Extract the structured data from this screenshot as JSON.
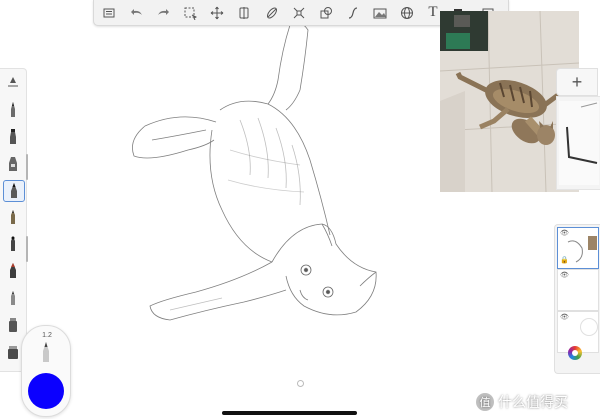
{
  "toolbar": {
    "tools": [
      {
        "icon": "layers-menu-icon"
      },
      {
        "icon": "undo-icon"
      },
      {
        "icon": "redo-icon"
      },
      {
        "icon": "selection-icon"
      },
      {
        "icon": "transform-icon"
      },
      {
        "icon": "symmetry-icon"
      },
      {
        "icon": "ruler-icon"
      },
      {
        "icon": "distort-icon"
      },
      {
        "icon": "shape-icon"
      },
      {
        "icon": "curve-icon"
      },
      {
        "icon": "image-import-icon"
      },
      {
        "icon": "perspective-grid-icon"
      },
      {
        "icon": "text-icon",
        "label": "T"
      },
      {
        "icon": "fill-icon"
      },
      {
        "icon": "fullscreen-icon"
      }
    ]
  },
  "brushes": {
    "items": [
      "brush-1",
      "brush-2",
      "brush-3",
      "brush-4",
      "brush-5",
      "brush-6",
      "brush-7",
      "brush-8",
      "brush-9",
      "brush-10",
      "brush-11"
    ],
    "selected_index": 4
  },
  "puck": {
    "size_label": "1.2",
    "color": "#0b00ff"
  },
  "layers_panel": {
    "add_label": "+"
  },
  "colors": {
    "toolbar_bg": "#f2f2f2",
    "selection": "#5c8fd6",
    "brush_color": "#0b00ff"
  },
  "watermark": {
    "badge": "值",
    "text": "什么值得买"
  }
}
